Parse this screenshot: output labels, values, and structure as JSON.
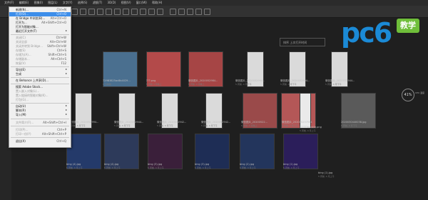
{
  "app": {
    "menubar": [
      "文件(F)",
      "编辑(E)",
      "图像(I)",
      "图层(L)",
      "文字(Y)",
      "选择(S)",
      "滤镜(T)",
      "3D(D)",
      "视图(V)",
      "窗口(W)",
      "帮助(H)"
    ]
  },
  "file_menu": {
    "items": [
      {
        "label": "新建(N)...",
        "shortcut": "Ctrl+N",
        "state": "normal"
      },
      {
        "label": "打开(O)...",
        "shortcut": "Ctrl+O",
        "state": "highlight"
      },
      {
        "label": "在 Bridge 中浏览(B)...",
        "shortcut": "Alt+Ctrl+O",
        "state": "normal"
      },
      {
        "label": "打开为...",
        "shortcut": "Alt+Shift+Ctrl+O",
        "state": "normal"
      },
      {
        "label": "打开为智能对象...",
        "shortcut": "",
        "state": "normal"
      },
      {
        "label": "最近打开文件(T)",
        "shortcut": "",
        "state": "submenu"
      },
      {
        "label": "关闭(C)",
        "shortcut": "Ctrl+W",
        "state": "disabled"
      },
      {
        "label": "关闭全部",
        "shortcut": "Alt+Ctrl+W",
        "state": "disabled"
      },
      {
        "label": "关闭并转到 Bridge...",
        "shortcut": "Shift+Ctrl+W",
        "state": "disabled"
      },
      {
        "label": "存储(S)",
        "shortcut": "Ctrl+S",
        "state": "disabled"
      },
      {
        "label": "存储为(A)...",
        "shortcut": "Shift+Ctrl+S",
        "state": "disabled"
      },
      {
        "label": "存储副本...",
        "shortcut": "Alt+Ctrl+S",
        "state": "disabled"
      },
      {
        "label": "恢复(V)",
        "shortcut": "F12",
        "state": "disabled"
      },
      {
        "label": "导出(E)",
        "shortcut": "",
        "state": "submenu"
      },
      {
        "label": "生成",
        "shortcut": "",
        "state": "submenu"
      },
      {
        "label": "在 Behance 上共享(D)...",
        "shortcut": "",
        "state": "normal"
      },
      {
        "label": "搜索 Adobe Stock...",
        "shortcut": "",
        "state": "normal"
      },
      {
        "label": "置入嵌入对象(L)...",
        "shortcut": "",
        "state": "disabled"
      },
      {
        "label": "置入链接的智能对象(K)...",
        "shortcut": "",
        "state": "disabled"
      },
      {
        "label": "打包(G)...",
        "shortcut": "",
        "state": "disabled"
      },
      {
        "label": "自动(U)",
        "shortcut": "",
        "state": "submenu"
      },
      {
        "label": "脚本(R)",
        "shortcut": "",
        "state": "submenu"
      },
      {
        "label": "导入(M)",
        "shortcut": "",
        "state": "submenu"
      },
      {
        "label": "文件简介(F)...",
        "shortcut": "Alt+Shift+Ctrl+I",
        "state": "disabled"
      },
      {
        "label": "打印(P)...",
        "shortcut": "Ctrl+P",
        "state": "disabled"
      },
      {
        "label": "打印一份(Y)",
        "shortcut": "Alt+Shift+Ctrl+P",
        "state": "disabled"
      },
      {
        "label": "退出(X)",
        "shortcut": "Ctrl+Q",
        "state": "normal"
      }
    ]
  },
  "sort": {
    "label": "排序",
    "value": "上次打开时间"
  },
  "files_row1": [
    {
      "name": "729B3825ac8b4029...",
      "meta": "1 分钟前"
    },
    {
      "name": "???.png",
      "meta": "5 周前 4 月晚上"
    },
    {
      "name": "微信图片_2020052984...",
      "meta": "5 周前, 4 月晚上"
    },
    {
      "name": "微信图片_2020052994...",
      "meta": "5 周前, 4 月下午"
    },
    {
      "name": "微信图片_2020052994...",
      "meta": "5 周前, 4 月下午"
    },
    {
      "name": "微信图片_2020052944...",
      "meta": "5 周前, 4 月下午"
    }
  ],
  "files_row2": [
    {
      "name": "微信图片_2020052994...",
      "meta": "5 周前, 4 月下午"
    },
    {
      "name": "微信图片_2020052944...",
      "meta": "5 周前, 4 月下午"
    },
    {
      "name": "微信图片_2020052942...",
      "meta": "5 周前, 4 月下午"
    },
    {
      "name": "微信图片_2020052942...",
      "meta": "5 周前, 4 月下午"
    },
    {
      "name": "微信图片_20200522...",
      "meta": "5 周前, 4 月晚上"
    },
    {
      "name": "微信图片_202005237554",
      "meta": "5 周前, 4 月上午"
    },
    {
      "name": "??????mobile.png",
      "meta": "5 周前, 4 月上午"
    },
    {
      "name": "2020030440038.jpg",
      "meta": "5 周前, 4 月下午"
    }
  ],
  "files_row3": [
    {
      "name": "bing (4).jpg",
      "meta": "5 周前, 4 月上午"
    },
    {
      "name": "bing (4).jpg",
      "meta": "5 周前, 4 月上午"
    },
    {
      "name": "bing (3).jpg",
      "meta": "5 周前, 4 月上午"
    },
    {
      "name": "bing (3).jpg",
      "meta": "5 周前, 4 月上午"
    },
    {
      "name": "bing (2).jpg",
      "meta": "5 周前, 4 月上午"
    },
    {
      "name": "bing (1).jpg",
      "meta": "5 周前, 4 月上午"
    },
    {
      "name": "bing (1).jpg",
      "meta": "5 周前, 4 月上午"
    }
  ],
  "logo": {
    "brand": "pc6",
    "tag": "教学",
    "color": "#1b8ad6",
    "tag_color": "#6fbe3a"
  },
  "badge": {
    "value": "41%",
    "sub": "CPU 温度"
  }
}
